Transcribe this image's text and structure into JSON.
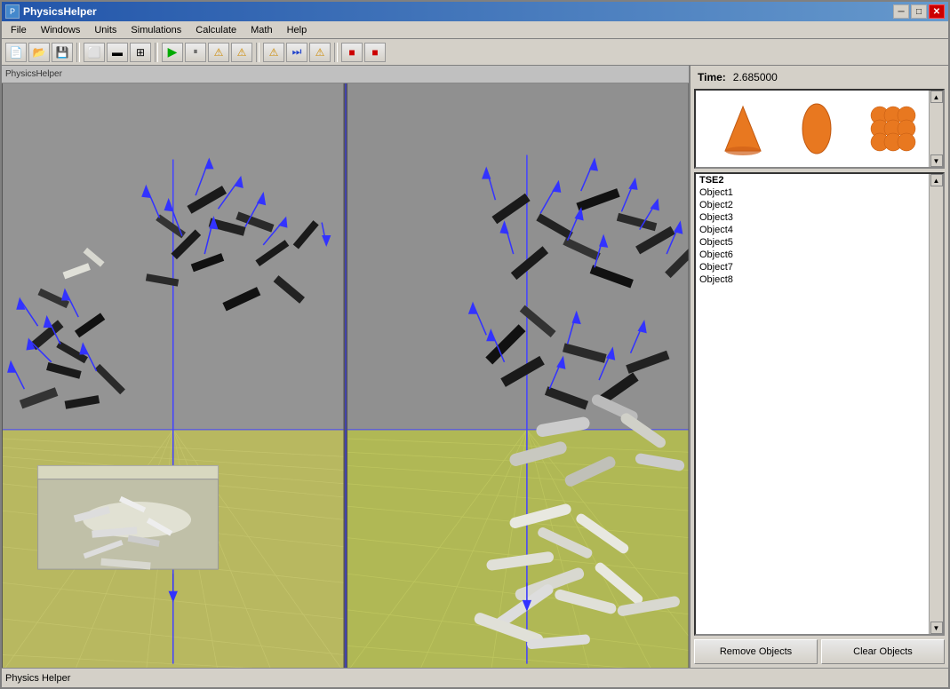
{
  "window": {
    "title": "PhysicsHelper",
    "icon": "P"
  },
  "titlebar": {
    "minimize_label": "─",
    "maximize_label": "□",
    "close_label": "✕"
  },
  "menu": {
    "items": [
      "File",
      "Windows",
      "Units",
      "Simulations",
      "Calculate",
      "Math",
      "Help"
    ]
  },
  "toolbar": {
    "buttons": [
      "new",
      "open",
      "save",
      "splitV",
      "splitH",
      "splitQ",
      "sep1",
      "play",
      "pause",
      "warn1",
      "warn2",
      "sep2",
      "warn3",
      "jump",
      "warn4",
      "sep3",
      "stop1",
      "stop2"
    ]
  },
  "viewport_header": {
    "label": "PhysicsHelper"
  },
  "side_panel": {
    "time_label": "Time:",
    "time_value": "2.685000"
  },
  "shapes": [
    {
      "name": "cone",
      "label": "cone"
    },
    {
      "name": "ellipse",
      "label": "ellipse"
    },
    {
      "name": "cluster",
      "label": "cluster"
    }
  ],
  "object_list": {
    "items": [
      {
        "id": "TSE2",
        "label": "TSE2"
      },
      {
        "id": "Object1",
        "label": "Object1"
      },
      {
        "id": "Object2",
        "label": "Object2"
      },
      {
        "id": "Object3",
        "label": "Object3"
      },
      {
        "id": "Object4",
        "label": "Object4"
      },
      {
        "id": "Object5",
        "label": "Object5"
      },
      {
        "id": "Object6",
        "label": "Object6"
      },
      {
        "id": "Object7",
        "label": "Object7"
      },
      {
        "id": "Object8",
        "label": "Object8"
      }
    ]
  },
  "buttons": {
    "remove_objects": "Remove Objects",
    "clear_objects": "Clear Objects"
  },
  "status_bar": {
    "text": "Physics Helper"
  }
}
